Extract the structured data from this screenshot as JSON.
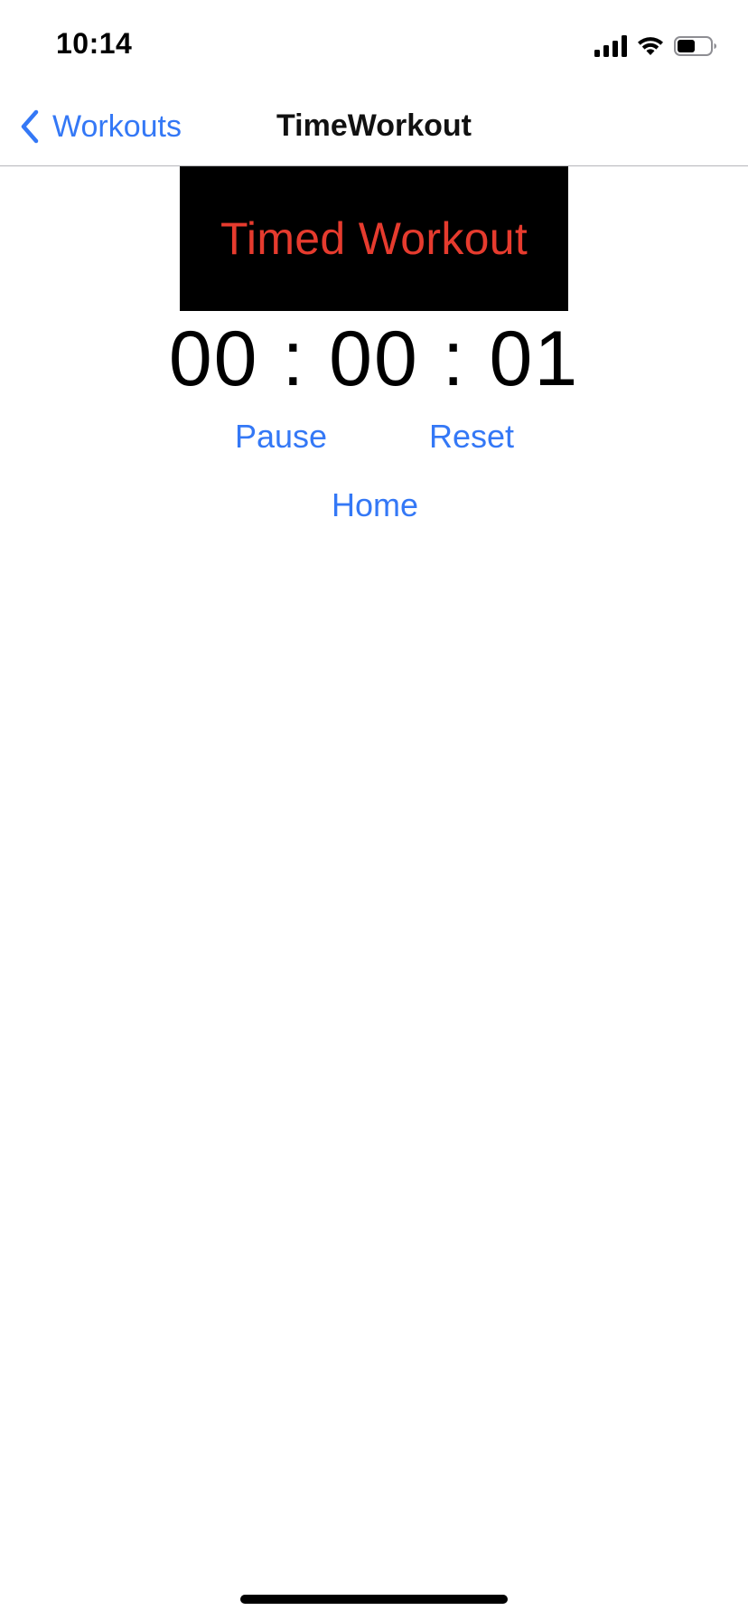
{
  "status_bar": {
    "time": "10:14",
    "icons": [
      "cellular-signal-icon",
      "wifi-icon",
      "battery-icon"
    ],
    "battery_level": 0.55
  },
  "nav": {
    "back_label": "Workouts",
    "back_icon": "chevron-left-icon",
    "title": "TimeWorkout"
  },
  "header": {
    "label": "Timed Workout"
  },
  "timer": {
    "display": "00 : 00 : 01"
  },
  "controls": {
    "pause_label": "Pause",
    "reset_label": "Reset",
    "home_label": "Home"
  },
  "colors": {
    "accent": "#3478f6",
    "header_text": "#e63b2e",
    "header_background": "#000000",
    "background": "#ffffff"
  }
}
